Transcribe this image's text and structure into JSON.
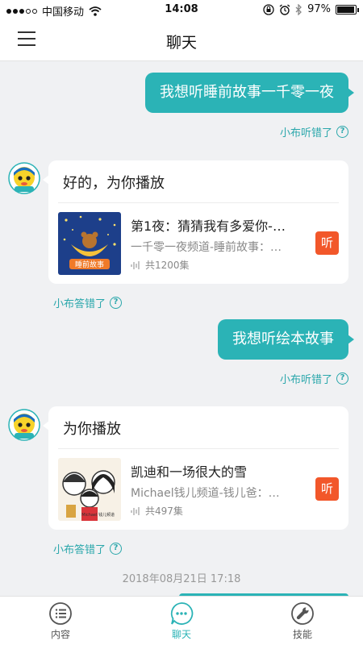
{
  "status_bar": {
    "carrier": "中国移动",
    "time": "14:08",
    "battery": "97%",
    "battery_level": 0.97
  },
  "header": {
    "title": "聊天",
    "menu_icon": "hamburger-menu-icon"
  },
  "messages": [
    {
      "user_text": "我想听睡前故事一千零一夜",
      "user_feedback": "小布听错了",
      "reply_text": "好的，为你播放",
      "media_title": "第1夜：猜猜我有多爱你-…",
      "media_subtitle": "一千零一夜频道-睡前故事：…",
      "media_count": "共1200集",
      "cover_caption": "睡前故事",
      "listen_label": "听",
      "reply_feedback": "小布答错了"
    },
    {
      "user_text": "我想听绘本故事",
      "user_feedback": "小布听错了",
      "reply_text": "为你播放",
      "media_title": "凯迪和一场很大的雪",
      "media_subtitle": "Michael钱儿频道-钱儿爸：…",
      "media_count": "共497集",
      "cover_caption": "Michael 钱儿频道",
      "listen_label": "听",
      "reply_feedback": "小布答错了"
    }
  ],
  "timestamp": "2018年08月21日 17:18",
  "tabs": [
    {
      "label": "内容",
      "icon": "list-icon",
      "active": false
    },
    {
      "label": "聊天",
      "icon": "chat-icon",
      "active": true
    },
    {
      "label": "技能",
      "icon": "skill-icon",
      "active": false
    }
  ],
  "colors": {
    "accent": "#2bb3b6",
    "listen_button": "#f2572a",
    "background": "#f0f1f3"
  }
}
